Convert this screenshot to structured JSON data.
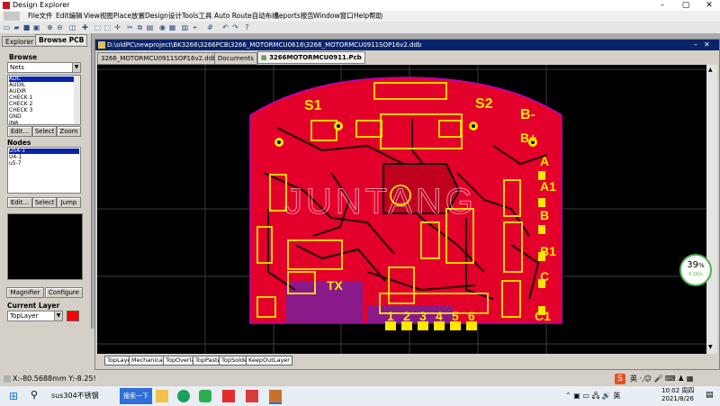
{
  "window": {
    "title": "Design Explorer",
    "buttons": [
      "–",
      "▢",
      "✕"
    ]
  },
  "menu": [
    "File文件",
    "Edit编辑",
    "View视图",
    "Place放置",
    "Design设计",
    "Tools工具",
    "Auto Route自动布线",
    "Reports报告",
    "Window窗口",
    "Help帮助"
  ],
  "left_panel": {
    "tabs": [
      "Explorer",
      "Browse PCB"
    ],
    "browse_label": "Browse",
    "browse_value": "Nets",
    "nets": [
      "ADC",
      "AUDIL",
      "AUDIR",
      "CHECK 1",
      "CHECK 2",
      "CHECK 3",
      "GND",
      "INA"
    ],
    "net_buttons": [
      "Edit...",
      "Select",
      "Zoom"
    ],
    "nodes_label": "Nodes",
    "nodes": [
      "U54-1",
      "U4-1",
      "u5-7"
    ],
    "node_buttons": [
      "Edit...",
      "Select",
      "Jump"
    ],
    "bottom_buttons": [
      "Magnifier",
      "Configure"
    ],
    "current_layer_label": "Current Layer",
    "current_layer_value": "TopLayer",
    "layer_color": "#ff0000"
  },
  "document": {
    "path": "D:\\oldPC\\newproject\\BK3266\\3266PCB\\3266_MOTORMCU0616\\3266_MOTORMCU0911SOP16v2.ddb",
    "tabs": [
      "3266_MOTORMCU0911SOP16v2.ddb",
      "Documents",
      "3266MOTORMCU0911.Pcb"
    ],
    "active_tab": 2,
    "layer_tabs": [
      "TopLayer",
      "Mechanical1",
      "TopOverlay",
      "TopPaste",
      "TopSolder",
      "KeepOutLayer"
    ],
    "watermark": "JUNTANG",
    "board_labels": [
      "S1",
      "S2",
      "B-",
      "B+",
      "A",
      "A1",
      "B",
      "B1",
      "C",
      "C1",
      "TX",
      "1",
      "2",
      "3",
      "4",
      "5",
      "6"
    ]
  },
  "status": {
    "coords": "X:-80.5688mm Y:-8.25!"
  },
  "perf_badge": {
    "value": "39",
    "unit": "%",
    "sub": "0.1K/s"
  },
  "taskbar": {
    "search_text": "sus304不锈钢",
    "search_button": "搜索一下",
    "time": "10:02 周四",
    "date": "2021/8/26"
  }
}
